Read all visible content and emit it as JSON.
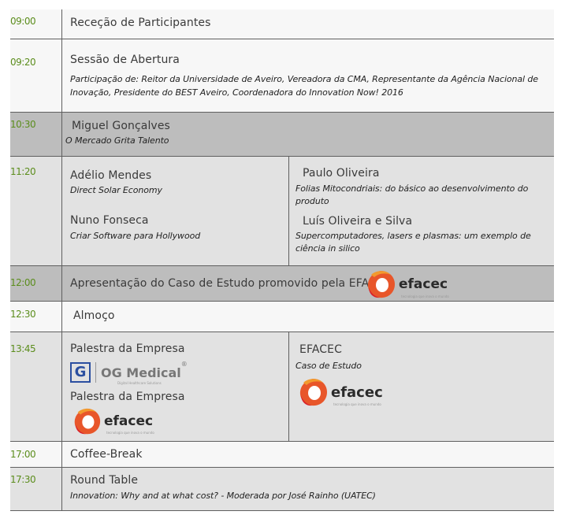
{
  "colors": {
    "time": "#5b8d1c",
    "row_white": "#f7f7f7",
    "row_light": "#e2e2e2",
    "row_dark": "#bdbdbd",
    "efacec_orange": "#e8562a",
    "efacec_red": "#d9232a"
  },
  "schedule": [
    {
      "time": "09:00",
      "title": "Receção de Participantes"
    },
    {
      "time": "09:20",
      "title": "Sessão de Abertura",
      "subtitle_l1": "Participação de: Reitor da Universidade de Aveiro, Vereadora da CMA, Representante da Agência Nacional de",
      "subtitle_l2": "Inovação, Presidente do BEST Aveiro, Coordenadora do Innovation Now! 2016"
    },
    {
      "time": "10:30",
      "title": "Miguel Gonçalves",
      "subtitle": "O Mercado Grita Talento"
    },
    {
      "time": "11:20",
      "left": [
        {
          "title": "Adélio Mendes",
          "subtitle": "Direct Solar Economy"
        },
        {
          "title": "Nuno Fonseca",
          "subtitle": "Criar Software para Hollywood"
        }
      ],
      "right": [
        {
          "title": "Paulo Oliveira",
          "subtitle_l1": "Folias Mitocondriais: do básico ao desenvolvimento do",
          "subtitle_l2": "produto"
        },
        {
          "title": "Luís Oliveira e Silva",
          "subtitle_l1": "Supercomputadores, lasers e plasmas: um exemplo de",
          "subtitle_l2": "ciência in silico"
        }
      ]
    },
    {
      "time": "12:00",
      "title": "Apresentação do Caso de Estudo promovido pela EFACEC"
    },
    {
      "time": "12:30",
      "title": "Almoço"
    },
    {
      "time": "13:45",
      "left": [
        {
          "title": "Palestra da Empresa"
        },
        {
          "title": "Palestra da Empresa"
        }
      ],
      "right": [
        {
          "title": "EFACEC",
          "subtitle": "Caso de Estudo"
        }
      ]
    },
    {
      "time": "17:00",
      "title": "Coffee-Break"
    },
    {
      "time": "17:30",
      "title": "Round Table",
      "subtitle": "Innovation: Why and at what cost? - Moderada por José Rainho (UATEC)"
    }
  ],
  "logos": {
    "efacec": {
      "name": "efacec",
      "tagline": "tecnologia que inova o mundo",
      "icon": "efacec-swirl-icon"
    },
    "og_medical": {
      "letter": "G",
      "name": "OG Medical",
      "mark": "®",
      "tagline": "Digital Healthcare Solutions",
      "icon": "og-medical-g-icon"
    }
  }
}
